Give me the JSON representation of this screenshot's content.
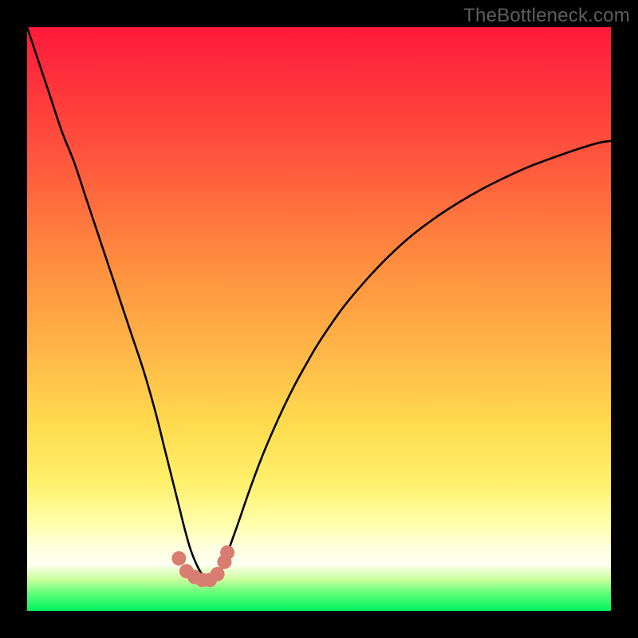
{
  "watermark": {
    "text": "TheBottleneck.com"
  },
  "colors": {
    "curve": "#000000",
    "dots_fill": "#d97c71",
    "dots_stroke": "#b85c52"
  },
  "chart_data": {
    "type": "line",
    "title": "",
    "xlabel": "",
    "ylabel": "",
    "xlim": [
      0,
      100
    ],
    "ylim": [
      0,
      100
    ],
    "grid": false,
    "series": [
      {
        "name": "bottleneck_percent",
        "x": [
          0,
          2,
          4,
          6,
          8,
          10,
          12,
          14,
          16,
          18,
          20,
          22,
          23.5,
          25,
          26,
          27,
          28,
          29,
          30,
          31,
          32,
          33,
          34,
          36,
          38,
          40,
          42,
          44,
          46,
          48,
          50,
          54,
          58,
          62,
          66,
          70,
          74,
          78,
          82,
          86,
          90,
          94,
          98,
          100
        ],
        "y": [
          100,
          94,
          88,
          82,
          77,
          71,
          65,
          59,
          53,
          47,
          41,
          34,
          28,
          22,
          18,
          14,
          10.5,
          8,
          6.2,
          5.3,
          5.3,
          6.4,
          9.0,
          14.6,
          20.4,
          25.8,
          30.6,
          35.0,
          39.0,
          42.6,
          46.0,
          51.8,
          56.6,
          60.8,
          64.4,
          67.4,
          70.0,
          72.3,
          74.3,
          76.1,
          77.6,
          79.0,
          80.2,
          80.5
        ]
      }
    ],
    "dots": {
      "name": "sample_points",
      "x": [
        26.0,
        27.3,
        28.7,
        30.0,
        31.3,
        32.6,
        33.8,
        34.3
      ],
      "y": [
        9.0,
        6.8,
        5.8,
        5.3,
        5.3,
        6.3,
        8.4,
        10.0
      ]
    }
  }
}
